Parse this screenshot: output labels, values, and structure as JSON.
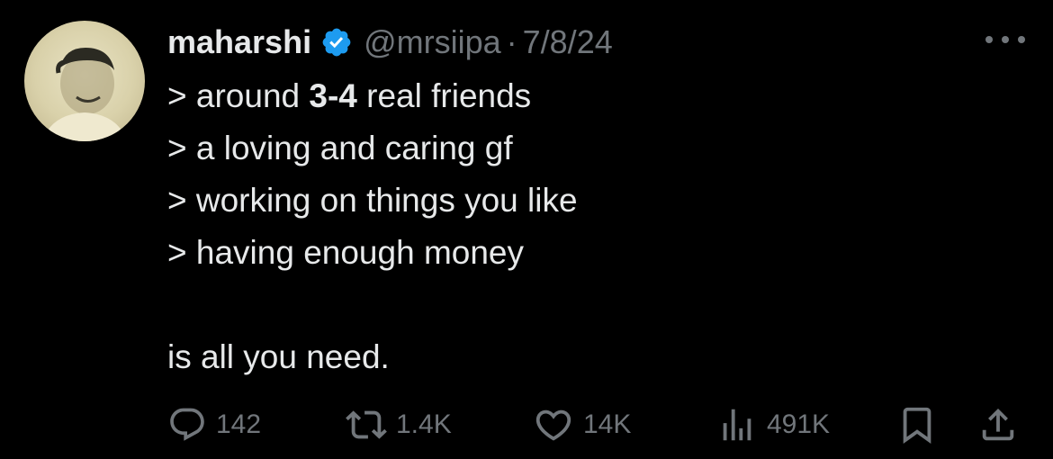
{
  "author": {
    "name": "maharshi",
    "handle": "@mrsiipa",
    "separator": "·",
    "date": "7/8/24",
    "verified": true,
    "avatar_icon": "avatar-photo"
  },
  "more_icon": "more-icon",
  "content": {
    "line1_prefix": "> around ",
    "line1_bold": "3-4",
    "line1_suffix": " real friends",
    "line2": "> a loving and caring gf",
    "line3": "> working on things you like",
    "line4": "> having enough money",
    "line5": "is all you need."
  },
  "actions": {
    "replies": {
      "icon": "reply-icon",
      "count": "142"
    },
    "reposts": {
      "icon": "repost-icon",
      "count": "1.4K"
    },
    "likes": {
      "icon": "like-icon",
      "count": "14K"
    },
    "views": {
      "icon": "views-icon",
      "count": "491K"
    },
    "bookmark": {
      "icon": "bookmark-icon"
    },
    "share": {
      "icon": "share-icon"
    }
  },
  "colors": {
    "background": "#000000",
    "text": "#e7e9ea",
    "muted": "#71767b",
    "verified": "#1d9bf0"
  }
}
